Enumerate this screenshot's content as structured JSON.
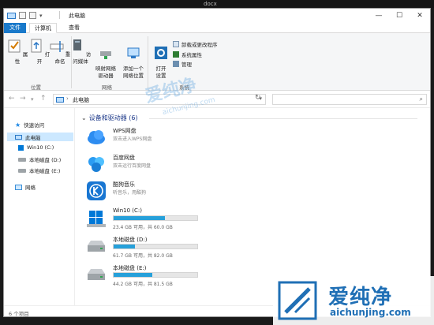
{
  "top_bar": {
    "doc_label": "docx"
  },
  "titlebar": {
    "title": "此电脑"
  },
  "tabs": [
    "文件",
    "计算机",
    "查看"
  ],
  "ribbon": {
    "location_group": {
      "label": "位置",
      "buttons": [
        "属性",
        "打开",
        "重命名"
      ]
    },
    "network_group": {
      "label": "网络",
      "buttons": [
        "访问媒体",
        "映射网络\n驱动器",
        "添加一个\n网络位置"
      ]
    },
    "system_group": {
      "label": "系统",
      "big_button": "打开\n设置",
      "commands": [
        "卸载或更改程序",
        "系统属性",
        "管理"
      ]
    }
  },
  "address_bar": {
    "crumb": "此电脑",
    "search_placeholder": ""
  },
  "sidebar": {
    "items": [
      {
        "label": "快速访问",
        "icon": "star-icon"
      },
      {
        "label": "此电脑",
        "icon": "this-pc-icon",
        "selected": true
      },
      {
        "label": "Win10 (C:)",
        "icon": "windows-drive-icon"
      },
      {
        "label": "本地磁盘 (D:)",
        "icon": "drive-icon"
      },
      {
        "label": "本地磁盘 (E:)",
        "icon": "drive-icon"
      },
      {
        "label": "网络",
        "icon": "network-icon"
      }
    ]
  },
  "content": {
    "group_title": "设备和驱动器 (6)",
    "apps": [
      {
        "name": "WPS网盘",
        "sub": "双击进入WPS网盘",
        "icon": "wps-cloud-icon"
      },
      {
        "name": "百度网盘",
        "sub": "双击运行百度网盘",
        "icon": "baidu-netdisk-icon"
      },
      {
        "name": "酷狗音乐",
        "sub": "听音乐，用酷狗",
        "icon": "kugou-music-icon"
      }
    ],
    "drives": [
      {
        "name": "Win10 (C:)",
        "capacity": "23.4 GB 可用，共 60.0 GB",
        "used_fraction": 0.61,
        "icon": "windows-drive-icon"
      },
      {
        "name": "本地磁盘 (D:)",
        "capacity": "61.7 GB 可用，共 82.0 GB",
        "used_fraction": 0.25,
        "icon": "drive-icon"
      },
      {
        "name": "本地磁盘 (E:)",
        "capacity": "44.2 GB 可用，共 81.5 GB",
        "used_fraction": 0.46,
        "icon": "drive-icon"
      }
    ]
  },
  "status": {
    "count": "6 个项目"
  },
  "watermark": {
    "brand": "爱纯净",
    "domain": "aichunjing.com"
  },
  "colors": {
    "accent": "#1979ca",
    "bar_fill": "#26a0da",
    "brand": "#1f6fb5"
  }
}
